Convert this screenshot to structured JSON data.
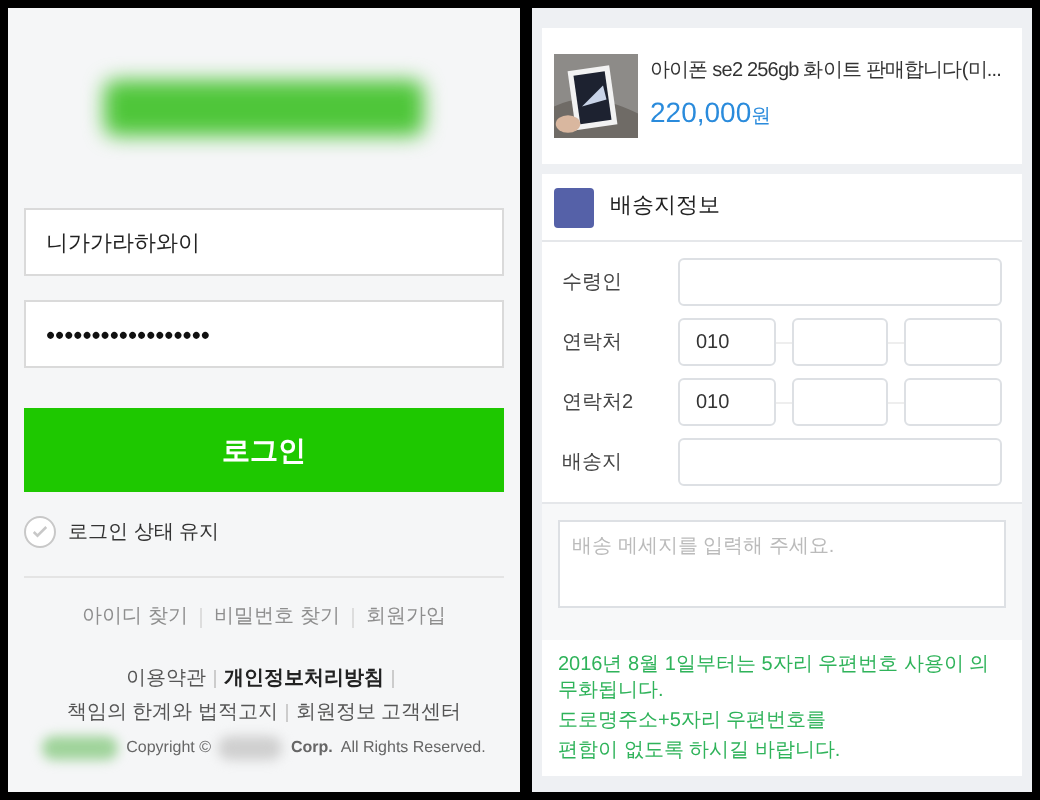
{
  "login": {
    "id_value": "니가가라하와이",
    "password_value": "••••••••••••••••••",
    "button": "로그인",
    "keep_login": {
      "label": "로그인 상태 유지",
      "checked": false
    }
  },
  "find_links": [
    "아이디 찾기",
    "비밀번호 찾기",
    "회원가입"
  ],
  "footer_links": [
    {
      "label": "이용약관",
      "bold": false
    },
    {
      "label": "개인정보처리방침",
      "bold": true
    },
    {
      "label": "책임의 한계와 법적고지",
      "bold": false
    },
    {
      "label": "회원정보 고객센터",
      "bold": false
    }
  ],
  "copyright": [
    "Copyright ©",
    "Corp.",
    "All Rights Reserved."
  ],
  "product": {
    "title": "아이폰 se2 256gb 화이트 판매합니다(미...",
    "price": "220,000",
    "unit": "원"
  },
  "shipping": {
    "title": "배송지정보",
    "fields": [
      {
        "label": "수령인",
        "kind": "text"
      },
      {
        "label": "연락처",
        "kind": "phone",
        "prefix": "010"
      },
      {
        "label": "연락처2",
        "kind": "phone",
        "prefix": "010"
      },
      {
        "label": "배송지",
        "kind": "text"
      }
    ],
    "message_placeholder": "배송 메세지를 입력해 주세요.",
    "notice": [
      "2016년 8월 1일부터는 5자리 우편번호 사용이 의무화됩니다.",
      "도로명주소+5자리 우편번호를",
      "편함이 없도록 하시길 바랍니다."
    ]
  }
}
